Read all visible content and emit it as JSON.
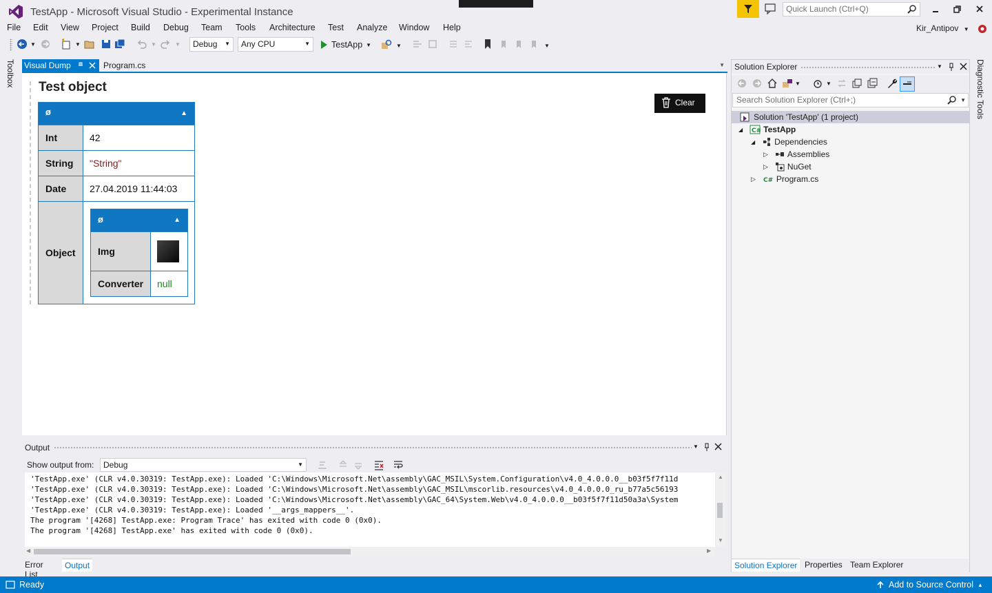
{
  "window": {
    "title": "TestApp - Microsoft Visual Studio  - Experimental Instance",
    "quick_launch_placeholder": "Quick Launch (Ctrl+Q)",
    "user": "Kir_Antipov"
  },
  "menu": [
    "File",
    "Edit",
    "View",
    "Project",
    "Build",
    "Debug",
    "Team",
    "Tools",
    "Architecture",
    "Test",
    "Analyze",
    "Window",
    "Help"
  ],
  "toolbar": {
    "config": "Debug",
    "platform": "Any CPU",
    "start_label": "TestApp"
  },
  "side_strips": {
    "left": "Toolbox",
    "right": "Diagnostic Tools"
  },
  "doc_tabs": [
    {
      "label": "Visual Dump",
      "active": true
    },
    {
      "label": "Program.cs",
      "active": false
    }
  ],
  "dump": {
    "title": "Test object",
    "clear_label": "Clear",
    "header_symbol": "ø",
    "rows": [
      {
        "key": "Int",
        "value": "42"
      },
      {
        "key": "String",
        "value": "\"String\""
      },
      {
        "key": "Date",
        "value": "27.04.2019 11:44:03"
      },
      {
        "key": "Object",
        "value": ""
      }
    ],
    "nested": {
      "header_symbol": "ø",
      "rows": [
        {
          "key": "Img",
          "value": ""
        },
        {
          "key": "Converter",
          "value": "null"
        }
      ]
    },
    "colors": {
      "header": "#1077c3",
      "string": "#8b1a1a",
      "null": "#1a8a1a"
    }
  },
  "output": {
    "title": "Output",
    "show_from_label": "Show output from:",
    "source": "Debug",
    "lines": [
      "'TestApp.exe' (CLR v4.0.30319: TestApp.exe): Loaded 'C:\\Windows\\Microsoft.Net\\assembly\\GAC_MSIL\\System.Configuration\\v4.0_4.0.0.0__b03f5f7f11d",
      "'TestApp.exe' (CLR v4.0.30319: TestApp.exe): Loaded 'C:\\Windows\\Microsoft.Net\\assembly\\GAC_MSIL\\mscorlib.resources\\v4.0_4.0.0.0_ru_b77a5c56193",
      "'TestApp.exe' (CLR v4.0.30319: TestApp.exe): Loaded 'C:\\Windows\\Microsoft.Net\\assembly\\GAC_64\\System.Web\\v4.0_4.0.0.0__b03f5f7f11d50a3a\\System",
      "'TestApp.exe' (CLR v4.0.30319: TestApp.exe): Loaded '__args_mappers__'.",
      "The program '[4268] TestApp.exe: Program Trace' has exited with code 0 (0x0).",
      "The program '[4268] TestApp.exe' has exited with code 0 (0x0)."
    ]
  },
  "bottom_tabs": [
    {
      "label": "Error List",
      "active": false
    },
    {
      "label": "Output",
      "active": true
    }
  ],
  "solution_explorer": {
    "title": "Solution Explorer",
    "search_placeholder": "Search Solution Explorer (Ctrl+;)",
    "tree": [
      {
        "label": "Solution 'TestApp' (1 project)",
        "icon": "solution-icon"
      },
      {
        "label": "TestApp",
        "icon": "csharp-project-icon"
      },
      {
        "label": "Dependencies",
        "icon": "dependencies-icon"
      },
      {
        "label": "Assemblies",
        "icon": "assemblies-icon"
      },
      {
        "label": "NuGet",
        "icon": "nuget-icon"
      },
      {
        "label": "Program.cs",
        "icon": "csharp-file-icon"
      }
    ],
    "tabs": [
      {
        "label": "Solution Explorer",
        "active": true
      },
      {
        "label": "Properties",
        "active": false
      },
      {
        "label": "Team Explorer",
        "active": false
      }
    ]
  },
  "status": {
    "left": "Ready",
    "right": "Add to Source Control"
  }
}
